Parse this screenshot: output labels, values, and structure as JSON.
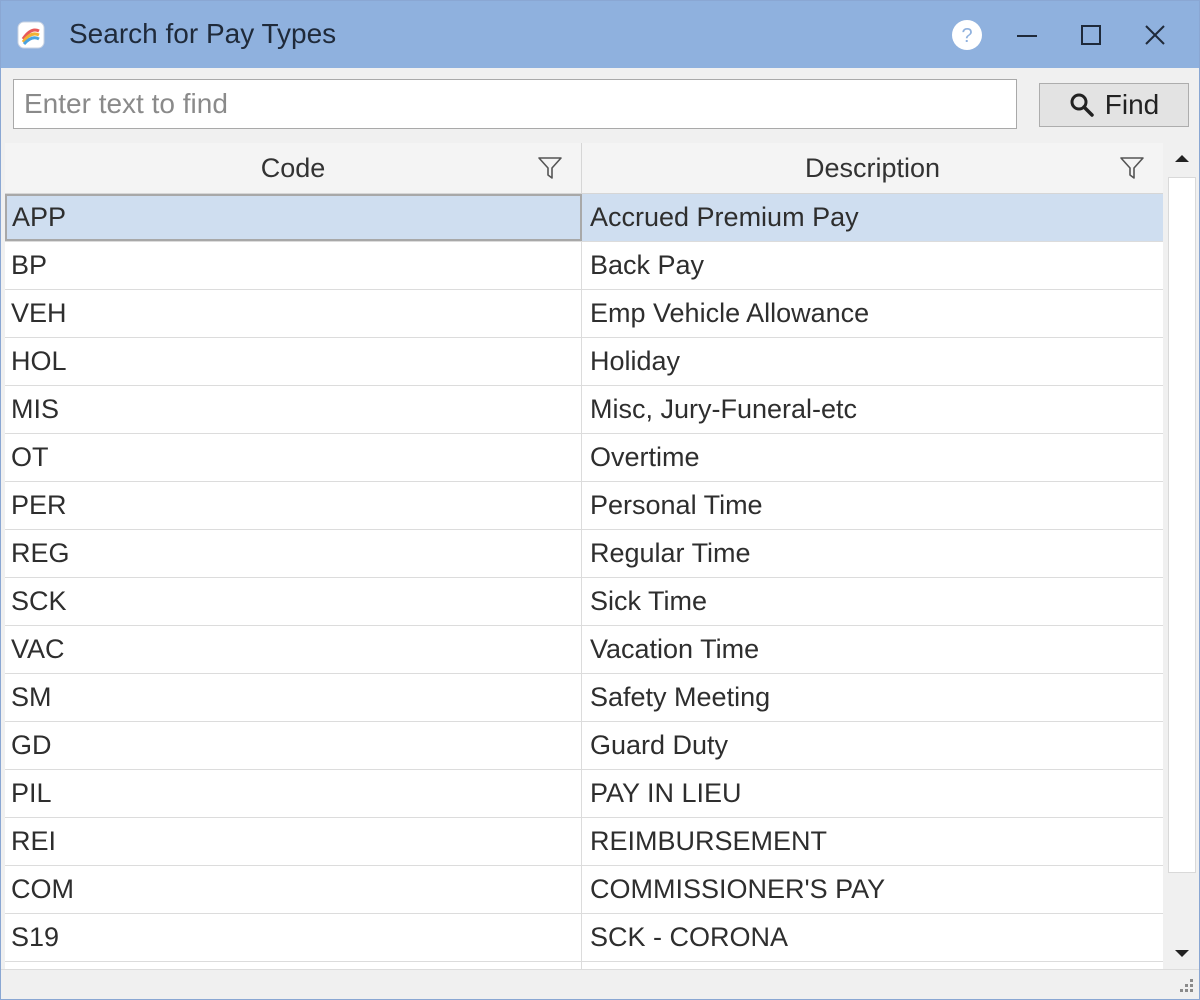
{
  "window": {
    "title": "Search for Pay Types",
    "icons": {
      "app": "app-logo-icon",
      "help": "help-icon",
      "minimize": "minimize-icon",
      "maximize": "maximize-icon",
      "close": "close-icon"
    }
  },
  "search": {
    "placeholder": "Enter text to find",
    "value": "",
    "find_label": "Find",
    "find_icon": "search-icon"
  },
  "grid": {
    "columns": [
      {
        "label": "Code",
        "filter_icon": "filter-icon"
      },
      {
        "label": "Description",
        "filter_icon": "filter-icon"
      }
    ],
    "selected_row": 0,
    "rows": [
      {
        "code": "APP",
        "description": "Accrued Premium Pay"
      },
      {
        "code": "BP",
        "description": "Back Pay"
      },
      {
        "code": "VEH",
        "description": "Emp Vehicle Allowance"
      },
      {
        "code": "HOL",
        "description": "Holiday"
      },
      {
        "code": "MIS",
        "description": "Misc, Jury-Funeral-etc"
      },
      {
        "code": "OT",
        "description": "Overtime"
      },
      {
        "code": "PER",
        "description": "Personal Time"
      },
      {
        "code": "REG",
        "description": "Regular Time"
      },
      {
        "code": "SCK",
        "description": "Sick Time"
      },
      {
        "code": "VAC",
        "description": "Vacation Time"
      },
      {
        "code": "SM",
        "description": "Safety Meeting"
      },
      {
        "code": "GD",
        "description": "Guard Duty"
      },
      {
        "code": "PIL",
        "description": "PAY IN LIEU"
      },
      {
        "code": "REI",
        "description": "REIMBURSEMENT"
      },
      {
        "code": "COM",
        "description": "COMMISSIONER'S PAY"
      },
      {
        "code": "S19",
        "description": "SCK - CORONA"
      }
    ]
  },
  "colors": {
    "titlebar": "#8fb1de",
    "selected_row": "#cfdef0"
  }
}
